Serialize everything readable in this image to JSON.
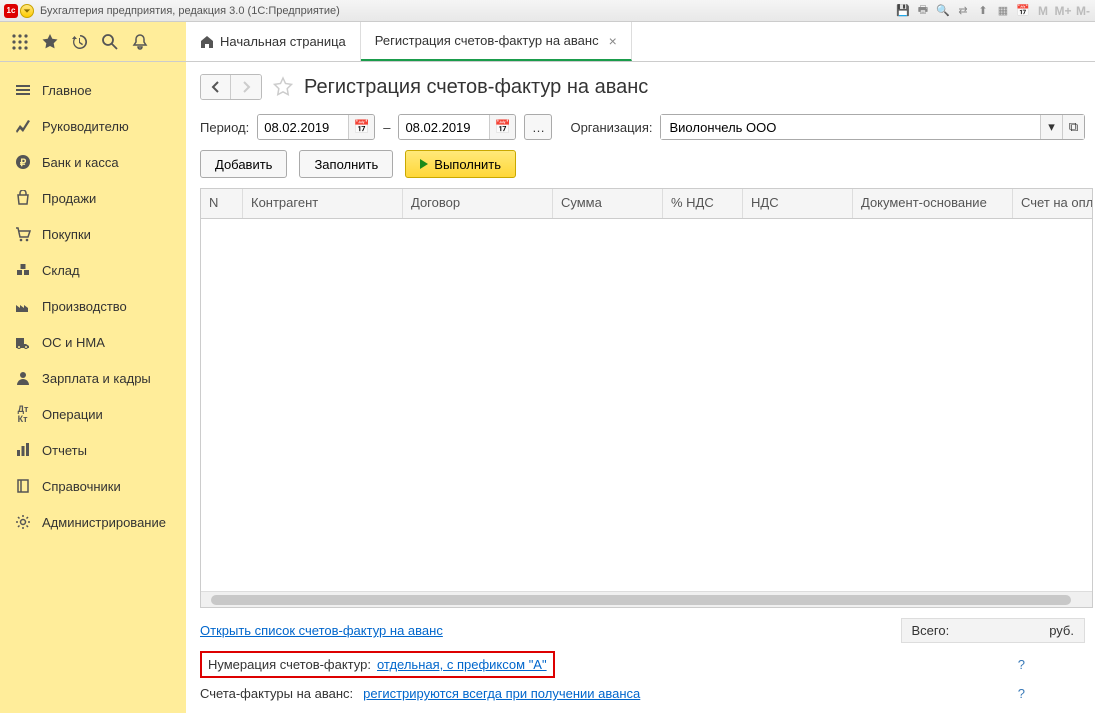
{
  "titlebar": {
    "text": "Бухгалтерия предприятия, редакция 3.0  (1С:Предприятие)"
  },
  "tabs": {
    "home": "Начальная страница",
    "active": "Регистрация счетов-фактур на аванс"
  },
  "sidebar": [
    {
      "label": "Главное"
    },
    {
      "label": "Руководителю"
    },
    {
      "label": "Банк и касса"
    },
    {
      "label": "Продажи"
    },
    {
      "label": "Покупки"
    },
    {
      "label": "Склад"
    },
    {
      "label": "Производство"
    },
    {
      "label": "ОС и НМА"
    },
    {
      "label": "Зарплата и кадры"
    },
    {
      "label": "Операции"
    },
    {
      "label": "Отчеты"
    },
    {
      "label": "Справочники"
    },
    {
      "label": "Администрирование"
    }
  ],
  "page": {
    "title": "Регистрация счетов-фактур на аванс",
    "period_label": "Период:",
    "date_from": "08.02.2019",
    "date_to": "08.02.2019",
    "org_label": "Организация:",
    "org_value": "Виолончель ООО",
    "btn_add": "Добавить",
    "btn_fill": "Заполнить",
    "btn_run": "Выполнить"
  },
  "columns": [
    "N",
    "Контрагент",
    "Договор",
    "Сумма",
    "% НДС",
    "НДС",
    "Документ-основание",
    "Счет на оплату"
  ],
  "footer": {
    "link1": "Открыть список счетов-фактур на аванс",
    "total_label": "Всего:",
    "total_unit": "руб.",
    "num_label": "Нумерация счетов-фактур:",
    "num_link": "отдельная, с префиксом \"А\"",
    "sf_label": "Счета-фактуры на аванс:",
    "sf_link": "регистрируются всегда при получении аванса",
    "q": "?"
  }
}
